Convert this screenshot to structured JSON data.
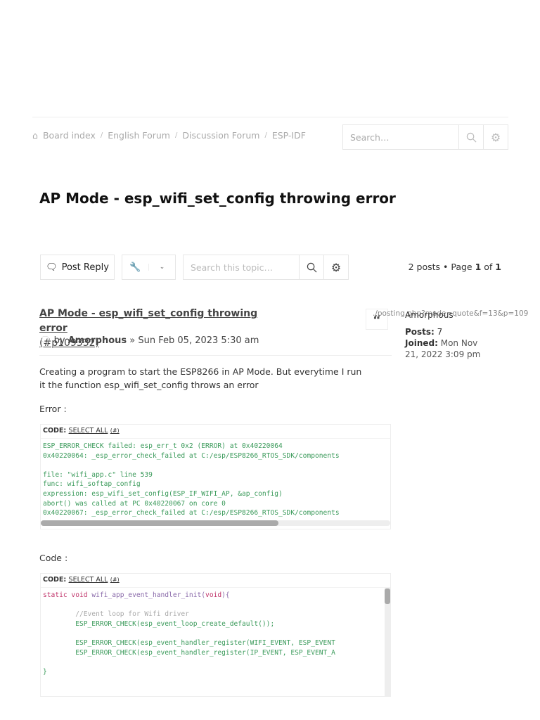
{
  "breadcrumb": [
    "Board index",
    "English Forum",
    "Discussion Forum",
    "ESP-IDF"
  ],
  "header_search": {
    "placeholder": "Search…"
  },
  "topic_title": "AP Mode - esp_wifi_set_config throwing error",
  "toolbar": {
    "post_reply": "Post Reply",
    "search_placeholder": "Search this topic…"
  },
  "pagination": {
    "posts": "2 posts • Page ",
    "current": "1",
    "of": " of ",
    "total": "1"
  },
  "post": {
    "title": "AP Mode - esp_wifi_set_config throwing error",
    "anchor": "(#p109332)",
    "by": "by ",
    "author": "Amorphous",
    "date": " » Sun Feb 05, 2023 5:30 am",
    "quote_url": "./posting.php?mode=quote&f=13&p=109",
    "body": "Creating a program to start the ESP8266 in AP Mode. But everytime I run it the function esp_wifi_set_config throws an error",
    "error_label": "Error :",
    "code_label": "Code :",
    "code_header": "CODE:",
    "select_all": "SELECT ALL",
    "hash": "(#)",
    "error_code": "ESP_ERROR_CHECK failed: esp_err_t 0x2 (ERROR) at 0x40220064\n0x40220064: _esp_error_check_failed at C:/esp/ESP8266_RTOS_SDK/components\n\nfile: \"wifi_app.c\" line 539\nfunc: wifi_softap_config\nexpression: esp_wifi_set_config(ESP_IF_WIFI_AP, &ap_config)\nabort() was called at PC 0x40220067 on core 0\n0x40220067: _esp_error_check_failed at C:/esp/ESP8266_RTOS_SDK/components",
    "code_lines": {
      "kw1": "static void ",
      "fn": "wifi_app_event_handler_init",
      "p1": "(",
      "kw2": "void",
      "p2": "){",
      "comment": "        //Event loop for Wifi driver",
      "l2": "        ESP_ERROR_CHECK(esp_event_loop_create_default());",
      "l3": "        ESP_ERROR_CHECK(esp_event_handler_register(WIFI_EVENT, ESP_EVENT",
      "l4": "        ESP_ERROR_CHECK(esp_event_handler_register(IP_EVENT, ESP_EVENT_A",
      "close": "}"
    }
  },
  "profile": {
    "name": "Amorphous",
    "posts_label": "Posts:",
    "posts": " 7",
    "joined_label": "Joined:",
    "joined": " Mon Nov 21, 2022 3:09 pm"
  }
}
